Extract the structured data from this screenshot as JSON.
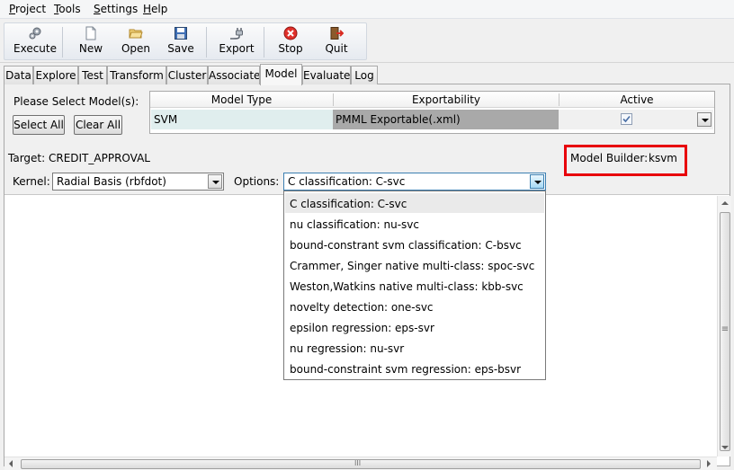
{
  "menubar": {
    "items": [
      {
        "label": "Project",
        "mnemonic": "P",
        "rest": "roject"
      },
      {
        "label": "Tools",
        "mnemonic": "T",
        "rest": "ools"
      },
      {
        "label": "Settings",
        "mnemonic": "S",
        "rest": "ettings"
      },
      {
        "label": "Help",
        "mnemonic": "H",
        "rest": "elp"
      }
    ]
  },
  "toolbar": {
    "execute": "Execute",
    "new": "New",
    "open": "Open",
    "save": "Save",
    "export": "Export",
    "stop": "Stop",
    "quit": "Quit"
  },
  "tabs": [
    "Data",
    "Explore",
    "Test",
    "Transform",
    "Cluster",
    "Associate",
    "Model",
    "Evaluate",
    "Log"
  ],
  "active_tab": "Model",
  "model_panel": {
    "select_prompt": "Please Select Model(s):",
    "select_all": "Select All",
    "clear_all": "Clear All",
    "table": {
      "headers": [
        "Model Type",
        "Exportability",
        "Active"
      ],
      "row": {
        "model_type": "SVM",
        "exportability": "PMML Exportable(.xml)",
        "active": true
      }
    },
    "target_label": "Target: CREDIT_APPROVAL",
    "model_builder_label": "Model Builder:",
    "model_builder_value": "ksvm",
    "kernel_label": "Kernel:",
    "kernel_value": "Radial Basis (rbfdot)",
    "options_label": "Options:",
    "options_value": "C classification: C-svc",
    "options_list": [
      "C classification: C-svc",
      "nu classification: nu-svc",
      "bound-constrant svm classification: C-bsvc",
      "Crammer, Singer native multi-class: spoc-svc",
      "Weston,Watkins native multi-class: kbb-svc",
      "novelty detection: one-svc",
      "epsilon regression: eps-svr",
      "nu regression: nu-svr",
      "bound-constraint svm regression: eps-bsvr"
    ]
  },
  "colors": {
    "highlight_box": "#e8000b",
    "model_type_cell": "#e0eeee",
    "export_cell": "#a9a9a9"
  },
  "scroll": {
    "hscroll_grip": "III",
    "vscroll_grip": "≡"
  }
}
